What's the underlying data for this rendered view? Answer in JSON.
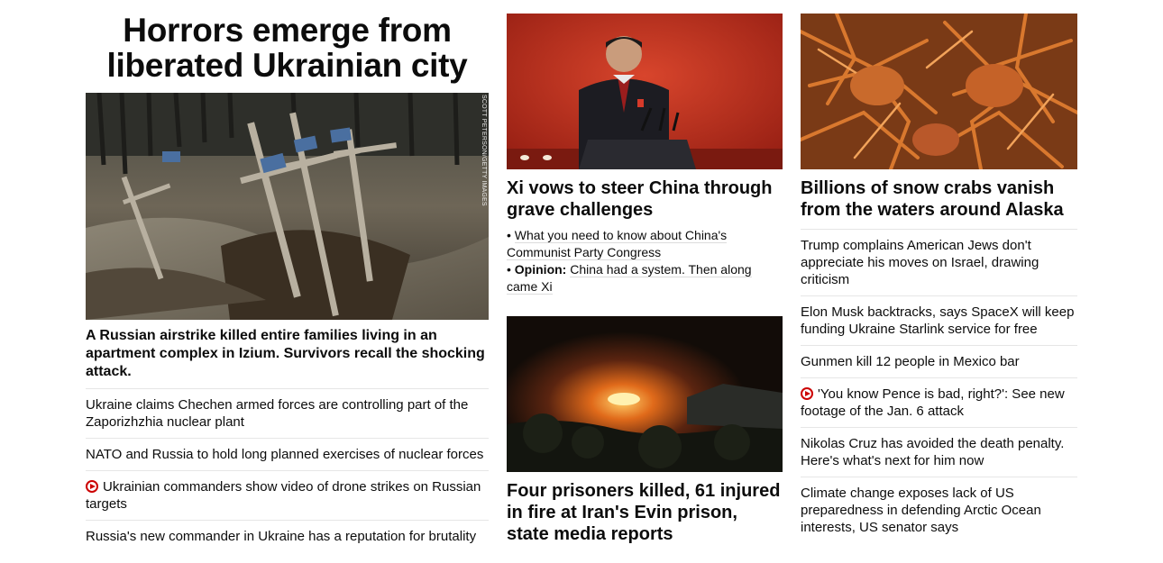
{
  "col1": {
    "headline": "Horrors emerge from liberated Ukrainian city",
    "image_credit": "SCOTT PETERSON/GETTY IMAGES",
    "lead_summary": "A Russian airstrike killed entire families living in an apartment complex in Izium. Survivors recall the shocking attack.",
    "items": [
      {
        "text": "Ukraine claims Chechen armed forces are controlling part of the Zaporizhzhia nuclear plant",
        "video": false
      },
      {
        "text": "NATO and Russia to hold long planned exercises of nuclear forces",
        "video": false
      },
      {
        "text": "Ukrainian commanders show video of drone strikes on Russian targets",
        "video": true
      },
      {
        "text": "Russia's new commander in Ukraine has a reputation for brutality",
        "video": false
      }
    ]
  },
  "col2": {
    "story1": {
      "headline": "Xi vows to steer China through grave challenges",
      "links": [
        {
          "prefix": "",
          "text": "What you need to know about China's Communist Party Congress"
        },
        {
          "prefix": "Opinion:",
          "text": "China had a system. Then along came Xi"
        }
      ]
    },
    "story2": {
      "headline": "Four prisoners killed, 61 injured in fire at Iran's Evin prison, state media reports"
    }
  },
  "col3": {
    "headline": "Billions of snow crabs vanish from the waters around Alaska",
    "items": [
      {
        "text": "Trump complains American Jews don't appreciate his moves on Israel, drawing criticism",
        "video": false
      },
      {
        "text": "Elon Musk backtracks, says SpaceX will keep funding Ukraine Starlink service for free",
        "video": false
      },
      {
        "text": "Gunmen kill 12 people in Mexico bar",
        "video": false
      },
      {
        "text": "'You know Pence is bad, right?': See new footage of the Jan. 6 attack",
        "video": true
      },
      {
        "text": "Nikolas Cruz has avoided the death penalty. Here's what's next for him now",
        "video": false
      },
      {
        "text": "Climate change exposes lack of US preparedness in defending Arctic Ocean interests, US senator says",
        "video": false
      }
    ]
  },
  "colors": {
    "video_red": "#cc0000",
    "text": "#0c0c0c",
    "divider": "#e6e6e6"
  },
  "icons": {
    "video": "play-circle-icon"
  }
}
